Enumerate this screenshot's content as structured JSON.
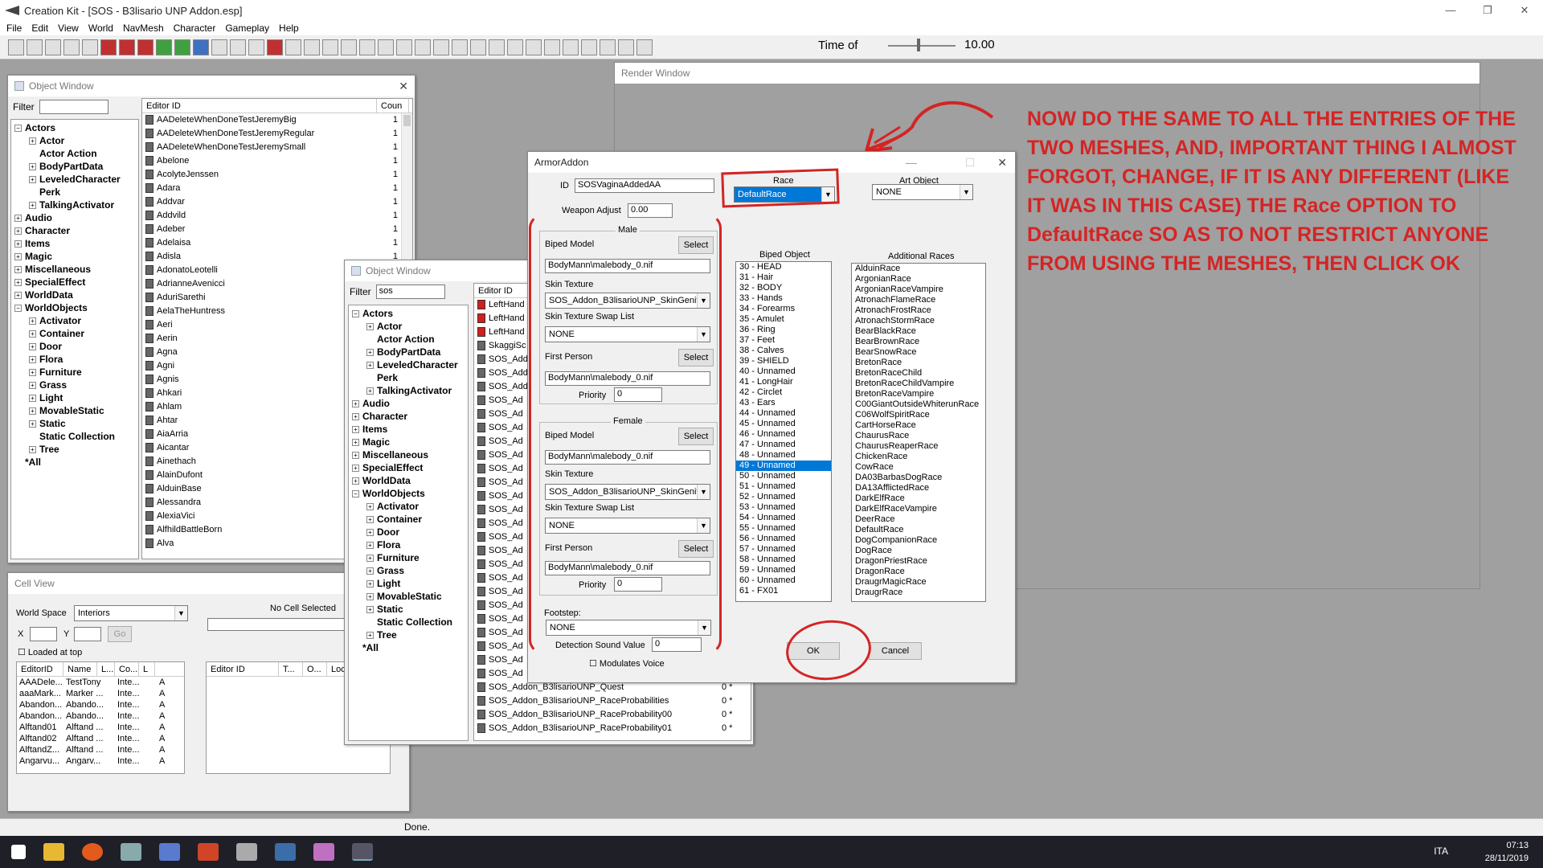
{
  "app": {
    "title": "Creation Kit - [SOS - B3lisario UNP Addon.esp]",
    "minimize": "—",
    "maximize": "❐",
    "close": "✕"
  },
  "menu": [
    "File",
    "Edit",
    "View",
    "World",
    "NavMesh",
    "Character",
    "Gameplay",
    "Help"
  ],
  "toolbar": {
    "time_label": "Time of",
    "time_value": "10.00",
    "time_fraction": 0.45
  },
  "object_window_1": {
    "title": "Object Window",
    "filter_label": "Filter",
    "filter_value": "",
    "tree": [
      {
        "t": "Actors",
        "lv": 0,
        "pm": "−"
      },
      {
        "t": "Actor",
        "lv": 1,
        "pm": "+"
      },
      {
        "t": "Actor Action",
        "lv": 1,
        "pm": ""
      },
      {
        "t": "BodyPartData",
        "lv": 1,
        "pm": "+"
      },
      {
        "t": "LeveledCharacter",
        "lv": 1,
        "pm": "+"
      },
      {
        "t": "Perk",
        "lv": 1,
        "pm": ""
      },
      {
        "t": "TalkingActivator",
        "lv": 1,
        "pm": "+"
      },
      {
        "t": "Audio",
        "lv": 0,
        "pm": "+"
      },
      {
        "t": "Character",
        "lv": 0,
        "pm": "+"
      },
      {
        "t": "Items",
        "lv": 0,
        "pm": "+"
      },
      {
        "t": "Magic",
        "lv": 0,
        "pm": "+"
      },
      {
        "t": "Miscellaneous",
        "lv": 0,
        "pm": "+"
      },
      {
        "t": "SpecialEffect",
        "lv": 0,
        "pm": "+"
      },
      {
        "t": "WorldData",
        "lv": 0,
        "pm": "+"
      },
      {
        "t": "WorldObjects",
        "lv": 0,
        "pm": "−"
      },
      {
        "t": "Activator",
        "lv": 1,
        "pm": "+"
      },
      {
        "t": "Container",
        "lv": 1,
        "pm": "+"
      },
      {
        "t": "Door",
        "lv": 1,
        "pm": "+"
      },
      {
        "t": "Flora",
        "lv": 1,
        "pm": "+"
      },
      {
        "t": "Furniture",
        "lv": 1,
        "pm": "+"
      },
      {
        "t": "Grass",
        "lv": 1,
        "pm": "+"
      },
      {
        "t": "Light",
        "lv": 1,
        "pm": "+"
      },
      {
        "t": "MovableStatic",
        "lv": 1,
        "pm": "+"
      },
      {
        "t": "Static",
        "lv": 1,
        "pm": "+"
      },
      {
        "t": "Static Collection",
        "lv": 1,
        "pm": ""
      },
      {
        "t": "Tree",
        "lv": 1,
        "pm": "+"
      },
      {
        "t": "*All",
        "lv": 0,
        "pm": ""
      }
    ],
    "col_editor_id": "Editor ID",
    "col_count": "Coun",
    "rows": [
      [
        "AADeleteWhenDoneTestJeremyBig",
        "1"
      ],
      [
        "AADeleteWhenDoneTestJeremyRegular",
        "1"
      ],
      [
        "AADeleteWhenDoneTestJeremySmall",
        "1"
      ],
      [
        "Abelone",
        "1"
      ],
      [
        "AcolyteJenssen",
        "1"
      ],
      [
        "Adara",
        "1"
      ],
      [
        "Addvar",
        "1"
      ],
      [
        "Addvild",
        "1"
      ],
      [
        "Adeber",
        "1"
      ],
      [
        "Adelaisa",
        "1"
      ],
      [
        "Adisla",
        "1"
      ],
      [
        "AdonatoLeotelli",
        "1"
      ],
      [
        "AdrianneAvenicci",
        "1"
      ],
      [
        "AduriSarethi",
        "1"
      ],
      [
        "AelaTheHuntress",
        "1"
      ],
      [
        "Aeri",
        "1"
      ],
      [
        "Aerin",
        "1"
      ],
      [
        "Agna",
        "1"
      ],
      [
        "Agni",
        "1"
      ],
      [
        "Agnis",
        "1"
      ],
      [
        "Ahkari",
        "1"
      ],
      [
        "Ahlam",
        "1"
      ],
      [
        "Ahtar",
        "1"
      ],
      [
        "AiaArria",
        "1"
      ],
      [
        "Aicantar",
        "1"
      ],
      [
        "Ainethach",
        "1"
      ],
      [
        "AlainDufont",
        "1"
      ],
      [
        "AlduinBase",
        "1"
      ],
      [
        "Alessandra",
        "1"
      ],
      [
        "AlexiaVici",
        "1"
      ],
      [
        "AlfhildBattleBorn",
        "1"
      ],
      [
        "Alva",
        "1"
      ]
    ]
  },
  "object_window_2": {
    "title": "Object Window",
    "filter_label": "Filter",
    "filter_value": "sos",
    "tree": [
      {
        "t": "Actors",
        "lv": 0,
        "pm": "−"
      },
      {
        "t": "Actor",
        "lv": 1,
        "pm": "+"
      },
      {
        "t": "Actor Action",
        "lv": 1,
        "pm": ""
      },
      {
        "t": "BodyPartData",
        "lv": 1,
        "pm": "+"
      },
      {
        "t": "LeveledCharacter",
        "lv": 1,
        "pm": "+"
      },
      {
        "t": "Perk",
        "lv": 1,
        "pm": ""
      },
      {
        "t": "TalkingActivator",
        "lv": 1,
        "pm": "+"
      },
      {
        "t": "Audio",
        "lv": 0,
        "pm": "+"
      },
      {
        "t": "Character",
        "lv": 0,
        "pm": "+"
      },
      {
        "t": "Items",
        "lv": 0,
        "pm": "+"
      },
      {
        "t": "Magic",
        "lv": 0,
        "pm": "+"
      },
      {
        "t": "Miscellaneous",
        "lv": 0,
        "pm": "+"
      },
      {
        "t": "SpecialEffect",
        "lv": 0,
        "pm": "+"
      },
      {
        "t": "WorldData",
        "lv": 0,
        "pm": "+"
      },
      {
        "t": "WorldObjects",
        "lv": 0,
        "pm": "−"
      },
      {
        "t": "Activator",
        "lv": 1,
        "pm": "+"
      },
      {
        "t": "Container",
        "lv": 1,
        "pm": "+"
      },
      {
        "t": "Door",
        "lv": 1,
        "pm": "+"
      },
      {
        "t": "Flora",
        "lv": 1,
        "pm": "+"
      },
      {
        "t": "Furniture",
        "lv": 1,
        "pm": "+"
      },
      {
        "t": "Grass",
        "lv": 1,
        "pm": "+"
      },
      {
        "t": "Light",
        "lv": 1,
        "pm": "+"
      },
      {
        "t": "MovableStatic",
        "lv": 1,
        "pm": "+"
      },
      {
        "t": "Static",
        "lv": 1,
        "pm": "+"
      },
      {
        "t": "Static Collection",
        "lv": 1,
        "pm": ""
      },
      {
        "t": "Tree",
        "lv": 1,
        "pm": "+"
      },
      {
        "t": "*All",
        "lv": 0,
        "pm": ""
      }
    ],
    "col_editor_id": "Editor ID",
    "rows": [
      "LeftHand",
      "LeftHand",
      "LeftHand",
      "SkaggiSc",
      "SOS_Add",
      "SOS_Add",
      "SOS_Add",
      "SOS_Ad",
      "SOS_Ad",
      "SOS_Ad",
      "SOS_Ad",
      "SOS_Ad",
      "SOS_Ad",
      "SOS_Ad",
      "SOS_Ad",
      "SOS_Ad",
      "SOS_Ad",
      "SOS_Ad",
      "SOS_Ad",
      "SOS_Ad",
      "SOS_Ad",
      "SOS_Ad",
      "SOS_Ad",
      "SOS_Ad",
      "SOS_Ad",
      "SOS_Ad",
      "SOS_Ad",
      "SOS_Ad",
      "SOS_Addon_B3lisarioUNP_Quest",
      "SOS_Addon_B3lisarioUNP_RaceProbabilities",
      "SOS_Addon_B3lisarioUNP_RaceProbability00",
      "SOS_Addon_B3lisarioUNP_RaceProbability01"
    ],
    "row_values": [
      "0 *",
      "0 *",
      "0 *",
      "0 *"
    ]
  },
  "render_window": {
    "title": "Render Window"
  },
  "annotation": "NOW DO THE SAME TO ALL THE ENTRIES OF THE TWO MESHES, AND, IMPORTANT THING I ALMOST FORGOT, CHANGE, IF IT IS ANY DIFFERENT (LIKE IT WAS IN THIS CASE) THE   Race  OPTION TO DefaultRace  SO AS TO NOT RESTRICT ANYONE FROM USING THE MESHES, THEN CLICK  OK",
  "cell_view": {
    "title": "Cell View",
    "world_space_label": "World Space",
    "world_space_value": "Interiors",
    "no_cell": "No Cell Selected",
    "x_label": "X",
    "y_label": "Y",
    "go": "Go",
    "loaded_at_top": "Loaded at top",
    "left_cols": [
      "EditorID",
      "Name",
      "L...",
      "Co...",
      "L"
    ],
    "left_rows": [
      [
        "AAADele...",
        "TestTony",
        "Inte...",
        "A"
      ],
      [
        "aaaMark...",
        "Marker ...",
        "Inte...",
        "A"
      ],
      [
        "Abandon...",
        "Abando...",
        "Inte...",
        "A"
      ],
      [
        "Abandon...",
        "Abando...",
        "Inte...",
        "A"
      ],
      [
        "Alftand01",
        "Alftand ...",
        "Inte...",
        "A"
      ],
      [
        "Alftand02",
        "Alftand ...",
        "Inte...",
        "A"
      ],
      [
        "AlftandZ...",
        "Alftand ...",
        "Inte...",
        "A"
      ],
      [
        "Angarvu...",
        "Angarv...",
        "Inte...",
        "A"
      ]
    ],
    "right_cols": [
      "Editor ID",
      "T...",
      "O...",
      "Loc..."
    ]
  },
  "armor_addon": {
    "title": "ArmorAddon",
    "id_label": "ID",
    "id_value": "SOSVaginaAddedAA",
    "weapon_adjust_label": "Weapon Adjust",
    "weapon_adjust_value": "0.00",
    "race_label": "Race",
    "race_value": "DefaultRace",
    "art_object_label": "Art Object",
    "art_object_value": "NONE",
    "male": {
      "caption": "Male",
      "biped_model": "Biped Model",
      "select": "Select",
      "model_path": "BodyMann\\malebody_0.nif",
      "skin_texture": "Skin Texture",
      "skin_value": "SOS_Addon_B3lisarioUNP_SkinGenit",
      "swap_list": "Skin Texture Swap List",
      "swap_value": "NONE",
      "first_person": "First Person",
      "fp_path": "BodyMann\\malebody_0.nif",
      "priority": "Priority",
      "priority_value": "0"
    },
    "female": {
      "caption": "Female",
      "biped_model": "Biped Model",
      "select": "Select",
      "model_path": "BodyMann\\malebody_0.nif",
      "skin_texture": "Skin Texture",
      "skin_value": "SOS_Addon_B3lisarioUNP_SkinGenit",
      "swap_list": "Skin Texture Swap List",
      "swap_value": "NONE",
      "first_person": "First Person",
      "fp_path": "BodyMann\\malebody_0.nif",
      "priority": "Priority",
      "priority_value": "0"
    },
    "footstep_label": "Footstep:",
    "footstep_value": "NONE",
    "detection_label": "Detection Sound Value",
    "detection_value": "0",
    "modulates_voice": "Modulates Voice",
    "biped_object_label": "Biped Object",
    "biped_objects": [
      "30 - HEAD",
      "31 - Hair",
      "32 - BODY",
      "33 - Hands",
      "34 - Forearms",
      "35 - Amulet",
      "36 - Ring",
      "37 - Feet",
      "38 - Calves",
      "39 - SHIELD",
      "40 - Unnamed",
      "41 - LongHair",
      "42 - Circlet",
      "43 - Ears",
      "44 - Unnamed",
      "45 - Unnamed",
      "46 - Unnamed",
      "47 - Unnamed",
      "48 - Unnamed",
      "49 - Unnamed",
      "50 - Unnamed",
      "51 - Unnamed",
      "52 - Unnamed",
      "53 - Unnamed",
      "54 - Unnamed",
      "55 - Unnamed",
      "56 - Unnamed",
      "57 - Unnamed",
      "58 - Unnamed",
      "59 - Unnamed",
      "60 - Unnamed",
      "61 - FX01"
    ],
    "biped_selected": "49 - Unnamed",
    "additional_races_label": "Additional Races",
    "additional_races": [
      "AlduinRace",
      "ArgonianRace",
      "ArgonianRaceVampire",
      "AtronachFlameRace",
      "AtronachFrostRace",
      "AtronachStormRace",
      "BearBlackRace",
      "BearBrownRace",
      "BearSnowRace",
      "BretonRace",
      "BretonRaceChild",
      "BretonRaceChildVampire",
      "BretonRaceVampire",
      "C00GiantOutsideWhiterunRace",
      "C06WolfSpiritRace",
      "CartHorseRace",
      "ChaurusRace",
      "ChaurusReaperRace",
      "ChickenRace",
      "CowRace",
      "DA03BarbasDogRace",
      "DA13AfflictedRace",
      "DarkElfRace",
      "DarkElfRaceVampire",
      "DeerRace",
      "DefaultRace",
      "DogCompanionRace",
      "DogRace",
      "DragonPriestRace",
      "DragonRace",
      "DraugrMagicRace",
      "DraugrRace"
    ],
    "ok": "OK",
    "cancel": "Cancel"
  },
  "status": {
    "text": "Done."
  },
  "tray": {
    "lang": "ITA",
    "time": "07:13",
    "date": "28/11/2019"
  },
  "colors": {
    "annotation_red": "#d42424",
    "selection_blue": "#0078d7",
    "taskbar": "#1f1f28"
  }
}
